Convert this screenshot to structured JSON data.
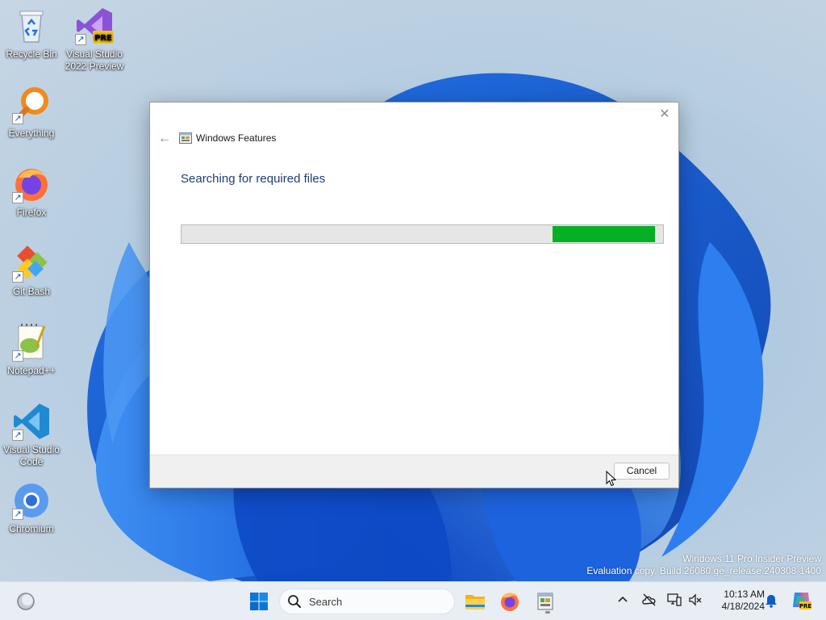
{
  "desktop": {
    "icons": [
      {
        "label_line1": "Recycle Bin",
        "label_line2": "",
        "icon": "recycle-bin-icon"
      },
      {
        "label_line1": "Visual Studio",
        "label_line2": "2022 Preview",
        "icon": "visual-studio-preview-icon",
        "badge": "PRE"
      },
      {
        "label_line1": "Everything",
        "label_line2": "",
        "icon": "everything-search-icon"
      },
      {
        "label_line1": "Firefox",
        "label_line2": "",
        "icon": "firefox-icon"
      },
      {
        "label_line1": "Git Bash",
        "label_line2": "",
        "icon": "git-bash-icon"
      },
      {
        "label_line1": "Notepad++",
        "label_line2": "",
        "icon": "notepad-plus-plus-icon"
      },
      {
        "label_line1": "Visual Studio",
        "label_line2": "Code",
        "icon": "vscode-icon"
      },
      {
        "label_line1": "Chromium",
        "label_line2": "",
        "icon": "chromium-icon"
      }
    ],
    "shortcut_arrow": "↗",
    "watermark_line1": "Windows 11 Pro Insider Preview",
    "watermark_line2": "Evaluation copy. Build 26080.ge_release.240308-1400"
  },
  "dialog": {
    "title": "Windows Features",
    "close_glyph": "✕",
    "back_glyph": "←",
    "heading": "Searching for required files",
    "progress": {
      "start_fraction": 0.77,
      "end_fraction": 0.982,
      "color": "#06b025"
    },
    "cancel_label": "Cancel"
  },
  "taskbar": {
    "search_placeholder": "Search",
    "clock_time": "10:13 AM",
    "clock_date": "4/18/2024",
    "copilot_badge": "PRE",
    "accent": "#0067c0"
  }
}
